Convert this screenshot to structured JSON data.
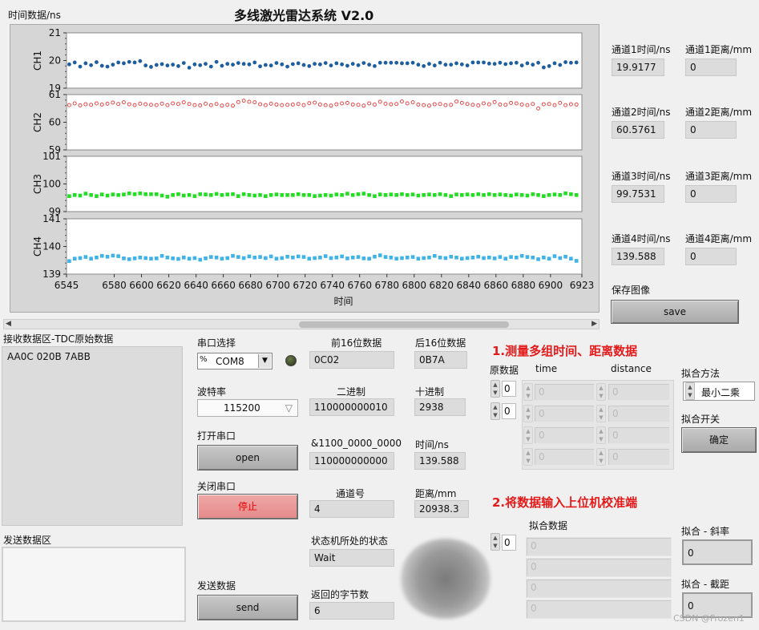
{
  "window": {
    "title": "多线激光雷达系统 V2.0"
  },
  "chart_data": {
    "type": "scatter",
    "ylabel": "时间数据/ns",
    "xlabel": "时间",
    "x_range": [
      6545,
      6923
    ],
    "x_ticks": [
      "6545",
      "6580",
      "6600",
      "6620",
      "6640",
      "6660",
      "6680",
      "6700",
      "6720",
      "6740",
      "6760",
      "6780",
      "6800",
      "6820",
      "6840",
      "6860",
      "6880",
      "6900",
      "6923"
    ],
    "x_tick_values": [
      6545,
      6580,
      6600,
      6620,
      6640,
      6660,
      6680,
      6700,
      6720,
      6740,
      6760,
      6780,
      6800,
      6820,
      6840,
      6860,
      6880,
      6900,
      6923
    ],
    "x_step": 4,
    "panels": [
      {
        "name": "CH1",
        "ylim": [
          19,
          21
        ],
        "ticks": [
          "21",
          "20",
          "19"
        ],
        "color": "#1f5fa0",
        "marker": "circle",
        "values": [
          19.86,
          19.93,
          19.78,
          19.9,
          19.83,
          19.94,
          19.81,
          19.78,
          19.85,
          19.93,
          19.9,
          19.95,
          19.93,
          19.98,
          19.82,
          19.77,
          19.84,
          19.87,
          19.82,
          19.85,
          19.8,
          19.91,
          19.74,
          19.86,
          19.83,
          19.88,
          19.78,
          19.95,
          19.81,
          19.88,
          19.85,
          19.91,
          19.88,
          19.86,
          19.93,
          19.79,
          19.84,
          19.82,
          19.91,
          19.86,
          19.78,
          19.87,
          19.9,
          19.84,
          19.8,
          19.88,
          19.86,
          19.91,
          19.82,
          19.9,
          19.86,
          19.81,
          19.88,
          19.83,
          19.91,
          19.85,
          19.8,
          19.92,
          19.92,
          19.92,
          19.92,
          19.9,
          19.9,
          19.92,
          19.85,
          19.8,
          19.88,
          19.82,
          19.92,
          19.85,
          19.85,
          19.9,
          19.86,
          19.82,
          19.93,
          19.93,
          19.93,
          19.89,
          19.88,
          19.92,
          19.87,
          19.9,
          19.92,
          19.82,
          19.9,
          19.85,
          19.92,
          19.75,
          19.8,
          19.9,
          19.84,
          19.94,
          19.92,
          19.93,
          19.93
        ]
      },
      {
        "name": "CH2",
        "ylim": [
          59,
          61
        ],
        "ticks": [
          "61",
          "60",
          "59"
        ],
        "color": "#e84a4a",
        "marker": "hollow-circle",
        "values": [
          60.62,
          60.68,
          60.61,
          60.65,
          60.63,
          60.68,
          60.64,
          60.67,
          60.71,
          60.66,
          60.72,
          60.65,
          60.62,
          60.67,
          60.65,
          60.63,
          60.62,
          60.67,
          60.62,
          60.68,
          60.66,
          60.72,
          60.66,
          60.62,
          60.61,
          60.67,
          60.62,
          60.66,
          60.6,
          60.63,
          60.6,
          60.73,
          60.78,
          60.74,
          60.72,
          60.65,
          60.62,
          60.67,
          60.64,
          60.62,
          60.63,
          60.64,
          60.66,
          60.62,
          60.69,
          60.71,
          60.64,
          60.62,
          60.6,
          60.65,
          60.68,
          60.7,
          60.64,
          60.63,
          60.6,
          60.68,
          60.64,
          60.74,
          60.67,
          60.65,
          60.66,
          60.75,
          60.68,
          60.72,
          60.64,
          60.62,
          60.6,
          60.65,
          60.66,
          60.62,
          60.63,
          60.75,
          60.7,
          60.66,
          60.63,
          60.61,
          60.68,
          60.65,
          60.73,
          60.64,
          60.63,
          60.7,
          60.68,
          60.64,
          60.62,
          60.66,
          60.5,
          60.65,
          60.66,
          60.62,
          60.7,
          60.62,
          60.65,
          60.64,
          60.62
        ]
      },
      {
        "name": "CH3",
        "ylim": [
          99,
          101
        ],
        "ticks": [
          "101",
          "100",
          "99"
        ],
        "color": "#22dd22",
        "marker": "square",
        "values": [
          99.56,
          99.6,
          99.58,
          99.65,
          99.6,
          99.56,
          99.62,
          99.58,
          99.62,
          99.6,
          99.62,
          99.66,
          99.63,
          99.66,
          99.63,
          99.63,
          99.63,
          99.58,
          99.54,
          99.6,
          99.63,
          99.58,
          99.6,
          99.56,
          99.63,
          99.62,
          99.6,
          99.64,
          99.6,
          99.62,
          99.63,
          99.56,
          99.63,
          99.6,
          99.58,
          99.6,
          99.56,
          99.6,
          99.62,
          99.6,
          99.6,
          99.6,
          99.63,
          99.6,
          99.6,
          99.56,
          99.58,
          99.6,
          99.58,
          99.62,
          99.6,
          99.65,
          99.6,
          99.63,
          99.65,
          99.6,
          99.56,
          99.62,
          99.6,
          99.62,
          99.6,
          99.63,
          99.6,
          99.62,
          99.58,
          99.6,
          99.62,
          99.6,
          99.63,
          99.6,
          99.56,
          99.62,
          99.6,
          99.62,
          99.6,
          99.63,
          99.6,
          99.63,
          99.6,
          99.62,
          99.6,
          99.58,
          99.62,
          99.6,
          99.58,
          99.63,
          99.6,
          99.56,
          99.6,
          99.62,
          99.6,
          99.66,
          99.63,
          99.6,
          99.6
        ]
      },
      {
        "name": "CH4",
        "ylim": [
          139,
          141
        ],
        "ticks": [
          "141",
          "140",
          "139"
        ],
        "color": "#3fb3e8",
        "marker": "square",
        "values": [
          139.47,
          139.56,
          139.58,
          139.62,
          139.56,
          139.6,
          139.66,
          139.63,
          139.67,
          139.65,
          139.57,
          139.54,
          139.57,
          139.6,
          139.58,
          139.56,
          139.57,
          139.66,
          139.6,
          139.57,
          139.55,
          139.6,
          139.56,
          139.58,
          139.52,
          139.57,
          139.62,
          139.6,
          139.56,
          139.58,
          139.66,
          139.62,
          139.58,
          139.64,
          139.6,
          139.62,
          139.58,
          139.64,
          139.56,
          139.58,
          139.63,
          139.6,
          139.64,
          139.62,
          139.56,
          139.58,
          139.6,
          139.65,
          139.58,
          139.6,
          139.64,
          139.57,
          139.6,
          139.62,
          139.57,
          139.56,
          139.63,
          139.68,
          139.62,
          139.6,
          139.56,
          139.58,
          139.6,
          139.62,
          139.56,
          139.58,
          139.6,
          139.66,
          139.6,
          139.58,
          139.63,
          139.6,
          139.56,
          139.58,
          139.6,
          139.63,
          139.58,
          139.6,
          139.57,
          139.62,
          139.56,
          139.62,
          139.6,
          139.66,
          139.62,
          139.6,
          139.54,
          139.6,
          139.56,
          139.65,
          139.58,
          139.63,
          139.56,
          139.48,
          139.6
        ]
      }
    ]
  },
  "channels": [
    {
      "time_label": "通道1时间/ns",
      "time_value": "19.9177",
      "dist_label": "通道1距离/mm",
      "dist_value": "0"
    },
    {
      "time_label": "通道2时间/ns",
      "time_value": "60.5761",
      "dist_label": "通道2距离/mm",
      "dist_value": "0"
    },
    {
      "time_label": "通道3时间/ns",
      "time_value": "99.7531",
      "dist_label": "通道3距离/mm",
      "dist_value": "0"
    },
    {
      "time_label": "通道4时间/ns",
      "time_value": "139.588",
      "dist_label": "通道4距离/mm",
      "dist_value": "0"
    }
  ],
  "save": {
    "label": "保存图像",
    "button": "save"
  },
  "receive": {
    "label": "接收数据区-TDC原始数据",
    "content": "AA0C 020B 7ABB"
  },
  "send": {
    "label": "发送数据区",
    "content": ""
  },
  "serial": {
    "port_label": "串口选择",
    "port_prefix": "%",
    "port_value": "COM8",
    "port_arrow": "▼",
    "baud_label": "波特率",
    "baud_value": "115200",
    "baud_arrow": "▽",
    "open_label": "打开串口",
    "open_button": "open",
    "close_label": "关闭串口",
    "close_button": "停止",
    "send_label": "发送数据",
    "send_button": "send"
  },
  "fields": {
    "first16_label": "前16位数据",
    "first16_value": "0C02",
    "last16_label": "后16位数据",
    "last16_value": "0B7A",
    "binary_label": "二进制",
    "binary_value": "110000000010",
    "decimal_label": "十进制",
    "decimal_value": "2938",
    "mask_label": "&1100_0000_0000",
    "mask_value": "110000000000",
    "time_label": "时间/ns",
    "time_value": "139.588",
    "channel_label": "通道号",
    "channel_value": "4",
    "distance_label": "距离/mm",
    "distance_value": "20938.3",
    "state_label": "状态机所处的状态",
    "state_value": "Wait",
    "bytes_label": "返回的字节数",
    "bytes_value": "6"
  },
  "measure": {
    "title": "1.测量多组时间、距离数据",
    "raw_label": "原数据",
    "time_col": "time",
    "distance_col": "distance",
    "index1": "0",
    "index2": "0",
    "time_cells": [
      "0",
      "0",
      "0",
      "0"
    ],
    "distance_cells": [
      "0",
      "0",
      "0",
      "0"
    ]
  },
  "fit": {
    "method_label": "拟合方法",
    "method_value": "最小二乘",
    "switch_label": "拟合开关",
    "switch_button": "确定",
    "slope_label": "拟合 - 斜率",
    "slope_value": "0",
    "intercept_label": "拟合 - 截距",
    "intercept_value": "0"
  },
  "calib": {
    "title": "2.将数据输入上位机校准端",
    "data_label": "拟合数据",
    "index": "0",
    "cells": [
      "0",
      "0",
      "0",
      "0"
    ]
  },
  "watermark": "CSDN @Frozen1"
}
